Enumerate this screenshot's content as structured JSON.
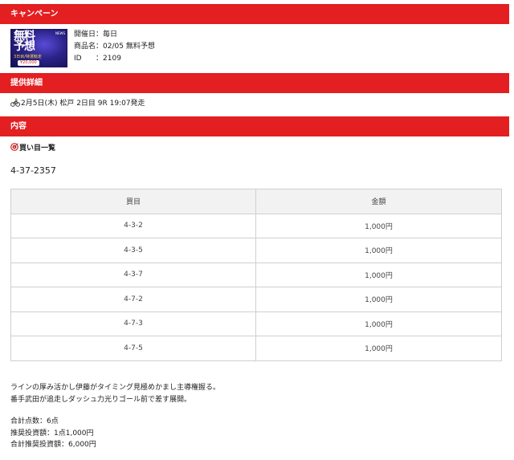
{
  "sections": {
    "campaign": "キャンペーン",
    "detail": "提供詳細",
    "content": "内容"
  },
  "campaign": {
    "thumbnail": {
      "title_line1": "無料",
      "title_line2": "予想",
      "subtitle": "3日目/特選競走",
      "price": "¥20,000",
      "badge": "NEWS"
    },
    "rows": [
      {
        "key": "開催日",
        "sep": "：",
        "value": "毎日"
      },
      {
        "key": "商品名",
        "sep": "：",
        "value": "02/05 無料予想"
      },
      {
        "key": "ID",
        "sep": "：",
        "value": "2109"
      }
    ]
  },
  "detail": {
    "icon": "bicycle-racer-icon",
    "text": "2月5日(木) 松戸 2日目 9R 19:07発走"
  },
  "content": {
    "list_icon": "target-icon",
    "list_heading": "買い目一覧",
    "combination": "4-37-2357",
    "table": {
      "headers": [
        "買目",
        "金額"
      ],
      "rows": [
        [
          "4-3-2",
          "1,000円"
        ],
        [
          "4-3-5",
          "1,000円"
        ],
        [
          "4-3-7",
          "1,000円"
        ],
        [
          "4-7-2",
          "1,000円"
        ],
        [
          "4-7-3",
          "1,000円"
        ],
        [
          "4-7-5",
          "1,000円"
        ]
      ]
    },
    "comment_lines": [
      "ラインの厚み活かし伊藤がタイミング見極めかまし主導権握る。",
      "番手武田が追走しダッシュ力光りゴール前で差す展開。"
    ],
    "totals": [
      "合計点数：6点",
      "推奨投資額：1点1,000円",
      "合計推奨投資額：6,000円"
    ]
  },
  "colors": {
    "accent": "#e31f21",
    "table_header_bg": "#f2f2f2",
    "table_border": "#cfcfcf"
  }
}
